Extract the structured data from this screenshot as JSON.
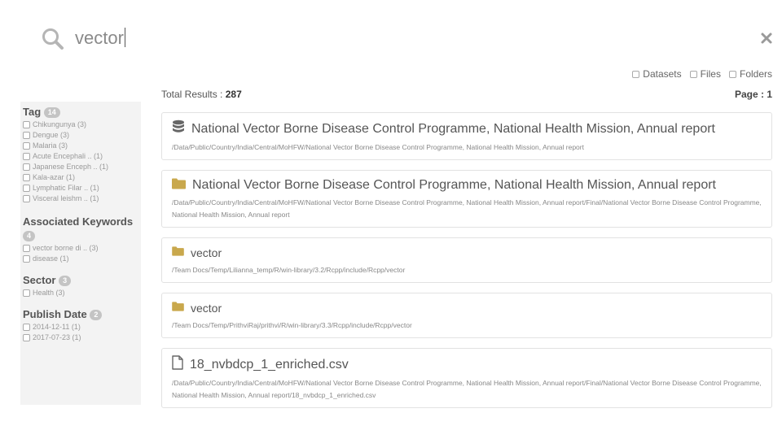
{
  "search": {
    "query": "vector",
    "icon": "search-icon",
    "close_icon": "close-icon"
  },
  "type_filters": [
    {
      "label": "Datasets"
    },
    {
      "label": "Files"
    },
    {
      "label": "Folders"
    }
  ],
  "summary": {
    "total_label": "Total Results :",
    "total_value": "287",
    "page_label": "Page : 1"
  },
  "facets": {
    "tag": {
      "title": "Tag",
      "count": "14",
      "items": [
        "Chikungunya (3)",
        "Dengue (3)",
        "Malaria (3)",
        "Acute Encephali .. (1)",
        "Japanese Enceph .. (1)",
        "Kala-azar (1)",
        "Lymphatic Filar .. (1)",
        "Visceral leishm .. (1)"
      ]
    },
    "keywords": {
      "title": "Associated Keywords",
      "count": "4",
      "items": [
        "vector borne di .. (3)",
        "disease (1)"
      ]
    },
    "sector": {
      "title": "Sector",
      "count": "3",
      "items": [
        "Health (3)"
      ]
    },
    "publish_date": {
      "title": "Publish Date",
      "count": "2",
      "items": [
        "2014-12-11 (1)",
        "2017-07-23 (1)"
      ]
    }
  },
  "results": [
    {
      "icon": "database-icon",
      "title": "National Vector Borne Disease Control Programme, National Health Mission, Annual report",
      "path": "/Data/Public/Country/India/Central/MoHFW/National Vector Borne Disease Control Programme, National Health Mission, Annual report"
    },
    {
      "icon": "folder-icon",
      "title": "National Vector Borne Disease Control Programme, National Health Mission, Annual report",
      "path": "/Data/Public/Country/India/Central/MoHFW/National Vector Borne Disease Control Programme, National Health Mission, Annual report/Final/National Vector Borne Disease Control Programme, National Health Mission, Annual report"
    },
    {
      "icon": "folder-icon",
      "title": "vector",
      "path": "/Team Docs/Temp/Lilianna_temp/R/win-library/3.2/Rcpp/include/Rcpp/vector"
    },
    {
      "icon": "folder-icon",
      "title": "vector",
      "path": "/Team Docs/Temp/PrithviRaj/prithvi/R/win-library/3.3/Rcpp/include/Rcpp/vector"
    },
    {
      "icon": "file-icon",
      "title": "18_nvbdcp_1_enriched.csv",
      "path": "/Data/Public/Country/India/Central/MoHFW/National Vector Borne Disease Control Programme, National Health Mission, Annual report/Final/National Vector Borne Disease Control Programme, National Health Mission, Annual report/18_nvbdcp_1_enriched.csv"
    }
  ],
  "colors": {
    "folder": "#c9a84c",
    "icon_gray": "#666666",
    "sidebar_bg": "#f3f3f3",
    "badge": "#c4c4c4"
  }
}
